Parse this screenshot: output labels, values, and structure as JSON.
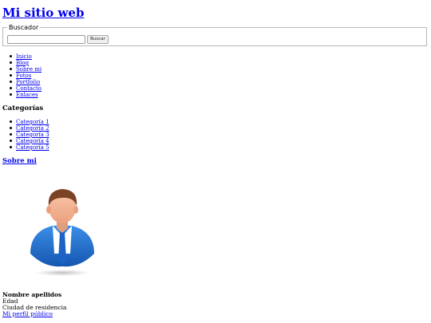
{
  "site": {
    "title": "Mi sitio web"
  },
  "search": {
    "legend": "Buscador",
    "placeholder": "",
    "value": "",
    "button_label": "Buscar"
  },
  "nav": {
    "items": [
      {
        "label": "Inicio"
      },
      {
        "label": "Blog"
      },
      {
        "label": "Sobre mi"
      },
      {
        "label": "Fotos"
      },
      {
        "label": "Portfolio"
      },
      {
        "label": "Contacto"
      },
      {
        "label": "Enlaces"
      }
    ]
  },
  "categories": {
    "heading": "Categorías",
    "items": [
      {
        "label": "Categoría 1"
      },
      {
        "label": "Categoría 2"
      },
      {
        "label": "Categoría 3"
      },
      {
        "label": "Categoría 4"
      },
      {
        "label": "Categoría 5"
      }
    ]
  },
  "about": {
    "heading": "Sobre mi",
    "avatar_icon": "businessman-avatar-icon",
    "name": "Nombre apellidos",
    "age": "Edad",
    "city": "Ciudad de residencia",
    "profile_link": "Mi perfil público"
  },
  "colors": {
    "link": "#0000ee",
    "avatar_suit": "#1e6fd0",
    "avatar_skin": "#f3b596",
    "avatar_hair": "#7a4326"
  }
}
